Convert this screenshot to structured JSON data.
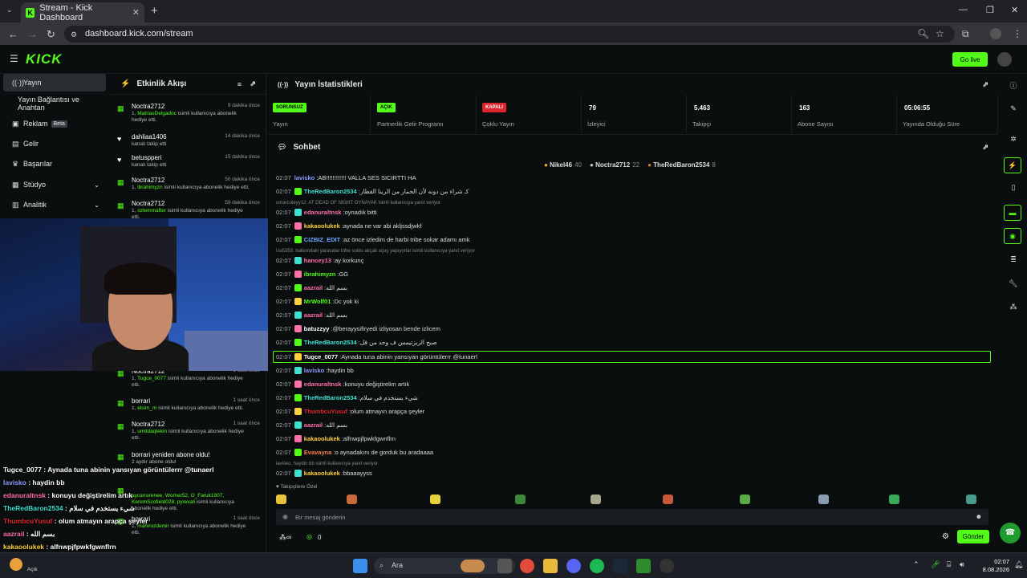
{
  "browser": {
    "tab_title": "Stream - Kick Dashboard",
    "url": "dashboard.kick.com/stream"
  },
  "header": {
    "logo": "KICK",
    "golive": "Go live"
  },
  "sidebar": {
    "items": [
      {
        "label": "Yayın",
        "icon": "stream-icon",
        "active": true
      },
      {
        "label": "Yayın Bağlantısı ve Anahtarı",
        "icon": ""
      },
      {
        "label": "Reklam",
        "icon": "ad-icon",
        "badge": "Beta"
      },
      {
        "label": "Gelir",
        "icon": "revenue-icon"
      },
      {
        "label": "Başarılar",
        "icon": "trophy-icon"
      },
      {
        "label": "Stüdyo",
        "icon": "studio-icon"
      },
      {
        "label": "Analitik",
        "icon": "chart-icon"
      }
    ]
  },
  "feed": {
    "title": "Etkinlik Akışı",
    "items": [
      {
        "name": "Noctra2712",
        "time": "9 dakika önce",
        "desc_pre": "1, ",
        "desc_user": "MatriasDelgadoc",
        "desc_post": " isimli kullanıcıya abonelik hediye etti."
      },
      {
        "name": "dahliaa1406",
        "time": "14 dakika önce",
        "desc_pre": "kanalı takip etti",
        "desc_user": "",
        "desc_post": ""
      },
      {
        "name": "betuspperi",
        "time": "15 dakika önce",
        "desc_pre": "kanalı takip etti",
        "desc_user": "",
        "desc_post": ""
      },
      {
        "name": "Noctra2712",
        "time": "50 dakika önce",
        "desc_pre": "1, ",
        "desc_user": "ibrahimyzn",
        "desc_post": " isimli kullanıcıya abonelik hediye etti."
      },
      {
        "name": "Noctra2712",
        "time": "59 dakika önce",
        "desc_pre": "1, ",
        "desc_user": "ozlemmafter",
        "desc_post": " isimli kullanıcıya abonelik hediye etti."
      },
      {
        "name": "Noctra2712",
        "time": "1 saat önce",
        "desc_pre": "1, ",
        "desc_user": "Tugce_0077",
        "desc_post": " isimli kullanıcıya abonelik hediye etti."
      },
      {
        "name": "borrari",
        "time": "1 saat önce",
        "desc_pre": "1, ",
        "desc_user": "elsim_m",
        "desc_post": " isimli kullanıcıya abonelik hediye etti."
      },
      {
        "name": "Noctra2712",
        "time": "1 saat önce",
        "desc_pre": "1, ",
        "desc_user": "umitdaqtekin",
        "desc_post": " isimli kullanıcıya abonelik hediye etti."
      },
      {
        "name": "borrari yeniden abone oldu!",
        "time": "",
        "desc_pre": "2 aydır abone oldu!",
        "desc_user": "",
        "desc_post": ""
      },
      {
        "name": "",
        "time": "",
        "desc_pre": "",
        "desc_user": "aycarrarenee, Womer52, O_Faruk1907, KeremScofield028, pyrexali",
        "desc_post": " isimli kullanıcıya abonelik hediye etti."
      },
      {
        "name": "borrari",
        "time": "1 saat önce",
        "desc_pre": "1, ",
        "desc_user": "mahirozdemir",
        "desc_post": " isimli kullanıcıya abonelik hediye etti."
      }
    ]
  },
  "stats": {
    "title": "Yayın İstatistikleri",
    "items": [
      {
        "badge": "SORUNSUZ",
        "badge_color": "#53fc18",
        "label": "Yayın"
      },
      {
        "badge": "AÇIK",
        "badge_color": "#53fc18",
        "label": "Partnerlik Gelir Programı"
      },
      {
        "badge": "KAPALI",
        "badge_color": "#e0242d",
        "label": "Çoklu Yayın"
      },
      {
        "value": "79",
        "label": "İzleyici"
      },
      {
        "value": "5.463",
        "label": "Takipçi"
      },
      {
        "value": "163",
        "label": "Abone Sayısı"
      },
      {
        "value": "05:06:55",
        "label": "Yayında Olduğu Süre"
      }
    ]
  },
  "chat": {
    "title": "Sohbet",
    "top": [
      {
        "name": "Nikel46",
        "n": "40"
      },
      {
        "name": "Noctra2712",
        "n": "22"
      },
      {
        "name": "TheRedBaron2534",
        "n": "8"
      }
    ],
    "lines": [
      {
        "t": "02:07",
        "u": "lavisko",
        "c": "#8e9cff",
        "m": "AB!!!!!!!!!!!! VALLA SES SICIRTTI HA"
      },
      {
        "t": "02:07",
        "u": "TheRedBaron2534",
        "c": "#40e0d0",
        "m": "كـ شراء من دونه لأن الحمار من الرينا القطار"
      },
      {
        "rep": "omarcoleyy12: AT DEAD OF NIGHT OYNAYAK isimli kullanıcıya yanıt veriyor"
      },
      {
        "t": "02:07",
        "u": "edanuraltnsk",
        "c": "#ff6fa8",
        "m": "oynadık bitti"
      },
      {
        "t": "02:07",
        "u": "kakaoolukek",
        "c": "#ffcf40",
        "m": "aynada ne var abi akljssdjwkf"
      },
      {
        "t": "02:07",
        "u": "CIZBIZ_EDIT",
        "c": "#6fa8ff",
        "m": "az önce izledim de harbi tribe sokar adamı amk"
      },
      {
        "rep": "Ua5353: balkondaki yarasalar tribe soktu akçak uçuş yapıyorlar isimli kullanıcıya yanıt veriyor"
      },
      {
        "t": "02:07",
        "u": "hancey13",
        "c": "#ff6fa8",
        "m": "ay korkunç"
      },
      {
        "t": "02:07",
        "u": "ibrahimyzn",
        "c": "#53fc18",
        "m": "GG"
      },
      {
        "t": "02:07",
        "u": "aazrail",
        "c": "#ff6fa8",
        "m": "بسم الله"
      },
      {
        "t": "02:07",
        "u": "MrWolf01",
        "c": "#53fc18",
        "m": "Dc yok ki"
      },
      {
        "t": "02:07",
        "u": "aazrail",
        "c": "#ff6fa8",
        "m": "بسم الله"
      },
      {
        "t": "02:07",
        "u": "batuzzyy",
        "c": "#fff",
        "m": "@berayysifiryedi izliyosan bende izlicem"
      },
      {
        "t": "02:07",
        "u": "TheRedBaron2534",
        "c": "#40e0d0",
        "m": "صبح الزيزتيمس ف وجد من قل"
      },
      {
        "t": "02:07",
        "u": "Tugce_0077",
        "c": "#fff",
        "m": "Aynada tuna abinin yansıyan görüntülerrr @tunaerl"
      },
      {
        "t": "02:07",
        "u": "lavisko",
        "c": "#8e9cff",
        "m": "haydin bb"
      },
      {
        "t": "02:07",
        "u": "edanuraltnsk",
        "c": "#ff6fa8",
        "m": "konuyu değiştirelim artık"
      },
      {
        "t": "02:07",
        "u": "TheRedBaron2534",
        "c": "#40e0d0",
        "m": "شيء يستخدم في سلام"
      },
      {
        "t": "02:07",
        "u": "ThumbcuYusuf",
        "c": "#e0242d",
        "m": "olum atmayın arapça şeyler"
      },
      {
        "t": "02:07",
        "u": "aazrail",
        "c": "#ff6fa8",
        "m": "بسم الله"
      },
      {
        "t": "02:07",
        "u": "kakaoolukek",
        "c": "#ffcf40",
        "m": "alfnwpjfpwkfgwnflrn"
      },
      {
        "t": "02:07",
        "u": "Evavayna",
        "c": "#ff7f50",
        "m": "o aynadakını de gorduk bu aradaaaa"
      },
      {
        "rep": "lavisko: haydin bb isimli kullanıcıya yanıt veriyor"
      },
      {
        "t": "02:07",
        "u": "kakaoolukek",
        "c": "#ffcf40",
        "m": "bbaaayyss"
      }
    ],
    "followers_label": "Takipçilere Özel",
    "placeholder": "Bir mesaj gönderin",
    "send": "Gönder",
    "points": "0"
  },
  "overlay": [
    {
      "u": "Tugce_0077",
      "c": "#fff",
      "m": "Aynada tuna abinin yansıyan görüntülerrr @tunaerl"
    },
    {
      "u": "lavisko",
      "c": "#8e9cff",
      "m": "haydin bb"
    },
    {
      "u": "edanuraltnsk",
      "c": "#ff6fa8",
      "m": "konuyu değiştirelim artık"
    },
    {
      "u": "TheRedBaron2534",
      "c": "#40e0d0",
      "m": "شيء يستخدم في سلام"
    },
    {
      "u": "ThumbcuYusuf",
      "c": "#e0242d",
      "m": "olum atmayın arapça şeyler"
    },
    {
      "u": "aazrail",
      "c": "#ff6fa8",
      "m": "بسم الله"
    },
    {
      "u": "kakaoolukek",
      "c": "#ffcf40",
      "m": "alfnwpjfpwkfgwnflrn"
    },
    {
      "u": "Evavayna",
      "c": "#ff7f50",
      "m": "o aynadakını de gorduk bu aradaaaa"
    },
    {
      "u": "kakaoolukek",
      "c": "#ffcf40",
      "m": "bbaaayyss"
    }
  ],
  "taskbar": {
    "search": "Ara",
    "time": "02:07",
    "date": "8.08.2026",
    "weather": "Açık"
  },
  "colors": {
    "accent": "#53fc18",
    "bg": "#0b0e0f"
  }
}
